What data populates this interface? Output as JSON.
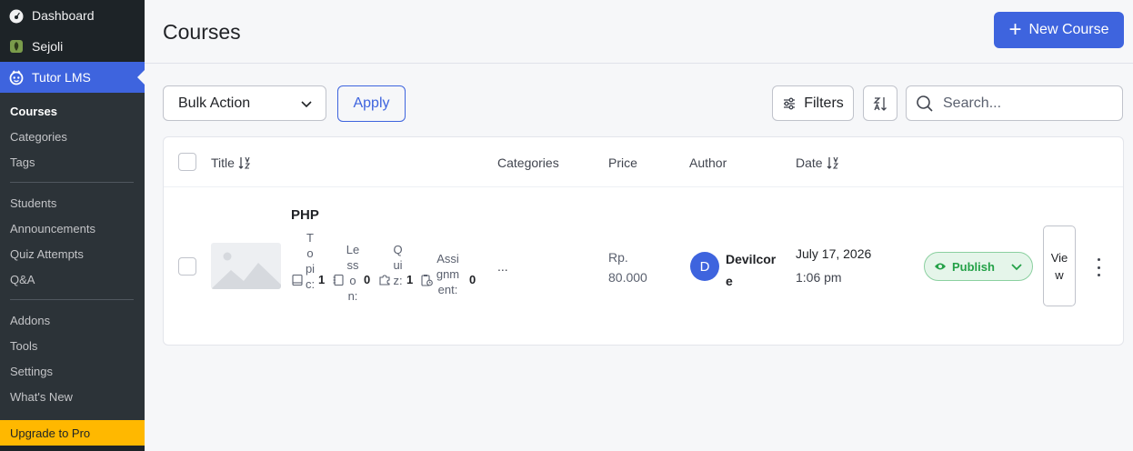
{
  "sidebar": {
    "top": [
      {
        "label": "Dashboard",
        "icon": "gauge-icon"
      },
      {
        "label": "Sejoli",
        "icon": "sejoli-icon"
      },
      {
        "label": "Tutor LMS",
        "icon": "tutor-icon"
      }
    ],
    "groups": [
      [
        "Courses",
        "Categories",
        "Tags"
      ],
      [
        "Students",
        "Announcements",
        "Quiz Attempts",
        "Q&A"
      ],
      [
        "Addons",
        "Tools",
        "Settings",
        "What's New"
      ]
    ],
    "upgrade": "Upgrade to Pro"
  },
  "header": {
    "title": "Courses",
    "new_course": "New Course"
  },
  "toolbar": {
    "bulk_action": "Bulk Action",
    "apply": "Apply",
    "filters": "Filters",
    "search_placeholder": "Search..."
  },
  "table": {
    "columns": {
      "title": "Title",
      "categories": "Categories",
      "price": "Price",
      "author": "Author",
      "date": "Date"
    },
    "rows": [
      {
        "title": "PHP",
        "topic_label": "Topic:",
        "topic_count": "1",
        "lesson_label": "Lesson:",
        "lesson_count": "0",
        "quiz_label": "Quiz:",
        "quiz_count": "1",
        "assignment_label": "Assignment:",
        "assignment_count": "0",
        "categories": "...",
        "price": "Rp. 80.000",
        "author_initial": "D",
        "author": "Devilcore",
        "date": "July 17, 2026",
        "time": "1:06 pm",
        "status": "Publish",
        "view": "View"
      }
    ]
  },
  "colors": {
    "accent": "#3e64de",
    "sidebar": "#1d2327",
    "upgrade": "#ffb800",
    "publish": "#24a148"
  }
}
